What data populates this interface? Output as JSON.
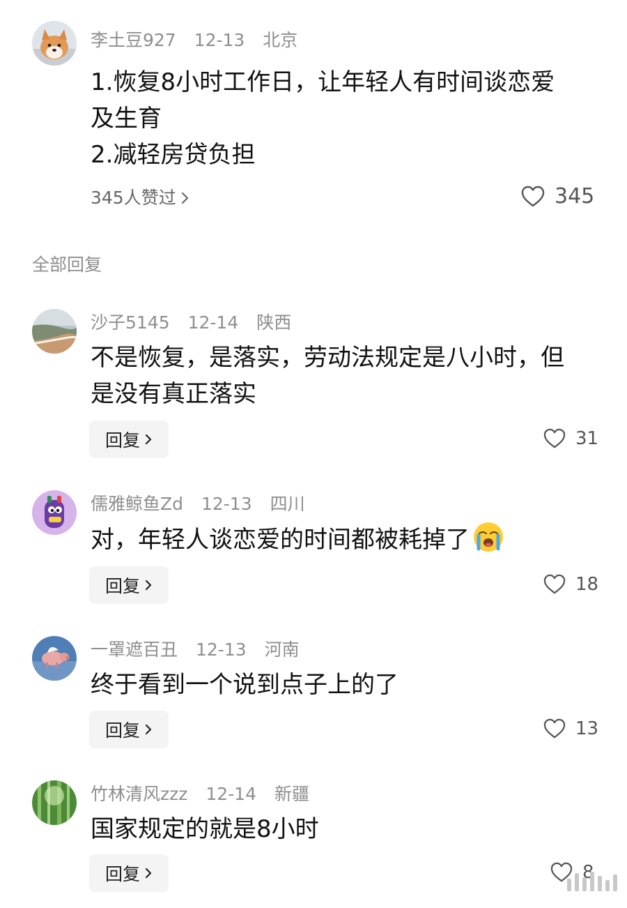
{
  "main_comment": {
    "user": "李土豆927",
    "date": "12-13",
    "location": "北京",
    "text_lines": [
      "1.恢复8小时工作日，让年轻人有时间谈恋爱",
      "及生育",
      "2.减轻房贷负担"
    ],
    "likes_summary": "345人赞过",
    "like_count": "345",
    "avatar_icon": "shiba-dog-avatar"
  },
  "replies_section": {
    "title": "全部回复"
  },
  "replies": [
    {
      "user": "沙子5145",
      "date": "12-14",
      "location": "陕西",
      "text_lines": [
        "不是恢复，是落实，劳动法规定是八小时，但",
        "是没有真正落实"
      ],
      "reply_label": "回复",
      "like_count": "31",
      "avatar_icon": "beach-avatar"
    },
    {
      "user": "儒雅鲸鱼Zd",
      "date": "12-13",
      "location": "四川",
      "text_lines": [
        "对，年轻人谈恋爱的时间都被耗掉了"
      ],
      "reply_label": "回复",
      "like_count": "18",
      "avatar_icon": "purple-cartoon-avatar",
      "emoji": "crying-face-emoji"
    },
    {
      "user": "一罩遮百丑",
      "date": "12-13",
      "location": "河南",
      "text_lines": [
        "终于看到一个说到点子上的了"
      ],
      "reply_label": "回复",
      "like_count": "13",
      "avatar_icon": "flying-pig-avatar"
    },
    {
      "user": "竹林清风zzz",
      "date": "12-14",
      "location": "新疆",
      "text_lines": [
        "国家规定的就是8小时"
      ],
      "reply_label": "回复",
      "like_count": "8",
      "avatar_icon": "bamboo-forest-avatar"
    }
  ],
  "colors": {
    "meta_text": "#8e8e8e",
    "body_text": "#111111",
    "reply_button_bg": "#f4f4f4"
  }
}
